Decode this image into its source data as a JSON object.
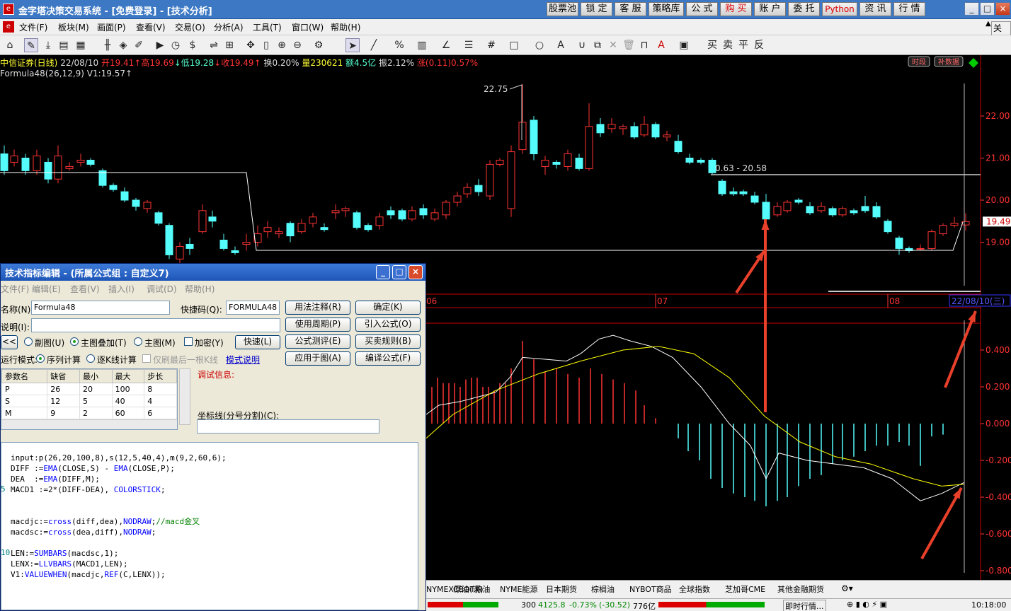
{
  "app": {
    "title": "金字塔决策交易系统 - [免费登录] - [技术分析]",
    "logo": "e"
  },
  "top_buttons": [
    "股票池",
    "锁 定",
    "客 服",
    "策略库",
    "公 式",
    "购 买",
    "账 户",
    "委 托",
    "Python",
    "资 讯",
    "行 情"
  ],
  "window_controls": {
    "minimize": "_",
    "restore": "□",
    "close": "×"
  },
  "menu": [
    "文件(F)",
    "板块(M)",
    "画面(P)",
    "查看(V)",
    "交易(O)",
    "分析(A)",
    "工具(T)",
    "窗口(W)",
    "帮助(H)"
  ],
  "menu_right": "关闭",
  "quote": {
    "name": "中信证券(日线)",
    "date": "22/08/10",
    "open": "开19.41",
    "high": "高19.69",
    "low": "低19.28",
    "close": "收19.49",
    "turnover": "换0.20%",
    "volume": "量230621",
    "amount": "额4.5亿",
    "amplitude": "振2.12%",
    "change": "涨(0.11)0.57%"
  },
  "formula_line": "Formula48(26,12,9) V1:19.57",
  "chart_badges": {
    "period": "时段",
    "supplement": "补数据"
  },
  "price_labels": {
    "peak": "22.75",
    "level": "0.63 - 20.58",
    "current": "19.49",
    "axis_ticks": [
      "22.00",
      "21.00",
      "20.00",
      "19.00"
    ]
  },
  "date_axis": {
    "labels": [
      "06",
      "07",
      "08"
    ],
    "current_date": "22/08/10(三)"
  },
  "macd_axis": {
    "ticks": [
      "0.400",
      "0.200",
      "0.000",
      "-0.200",
      "-0.400",
      "-0.600",
      "-0.800"
    ]
  },
  "dialog": {
    "title": "技术指标编辑 - (所属公式组 : 自定义7)",
    "menu": [
      "文件(F)",
      "编辑(E)",
      "查看(V)",
      "插入(I)",
      "调试(D)",
      "帮助(H)"
    ],
    "name_label": "名称(N):",
    "name_value": "Formula48",
    "shortcut_label": "快捷码(Q):",
    "shortcut_value": "FORMULA48",
    "desc_label": "说明(I):",
    "buttons": {
      "usage": "用法注释(R)",
      "ok": "确定(K)",
      "period": "使用周期(P)",
      "import": "引入公式(O)",
      "test": "公式测评(E)",
      "rules": "买卖规则(B)",
      "apply": "应用于图(A)",
      "compile": "编译公式(F)",
      "fast": "快速(L)",
      "back": "<<"
    },
    "radios": {
      "sub": "副图(U)",
      "overlay": "主图叠加(T)",
      "main": "主图(M)",
      "encrypt": "加密(Y)"
    },
    "run_mode_label": "运行模式:",
    "run_modes": {
      "serial": "序列计算",
      "single": "逐K线计算",
      "last": "仅刷最后一根K线"
    },
    "mode_link": "模式说明",
    "debug_label": "调试信息:",
    "axis_label": "坐标线(分号分割)(C):",
    "params_headers": [
      "参数名",
      "缺省",
      "最小",
      "最大",
      "步长"
    ],
    "params": [
      [
        "P",
        "26",
        "20",
        "100",
        "8"
      ],
      [
        "S",
        "12",
        "5",
        "40",
        "4"
      ],
      [
        "M",
        "9",
        "2",
        "60",
        "6"
      ]
    ]
  },
  "code_lines": [
    [
      "input",
      "",
      ":p(26,20,100,8),s(12,5,40,4),m(9,2,60,6);"
    ],
    [
      "DIFF :=",
      "EMA",
      "(CLOSE,S) - ",
      "EMA",
      "(CLOSE,P);"
    ],
    [
      "DEA  :=",
      "EMA",
      "(DIFF,M);"
    ],
    [
      "MACD1 :=2*(DIFF-DEA), ",
      "COLORSTICK",
      ";"
    ],
    [
      "",
      "",
      ""
    ],
    [
      "",
      "",
      ""
    ],
    [
      "macdjc:=",
      "cross",
      "(diff,dea),",
      "NODRAW",
      ";//macd金叉"
    ],
    [
      "macdsc:=",
      "cross",
      "(dea,diff),",
      "NODRAW",
      ";"
    ],
    [
      "",
      "",
      ""
    ],
    [
      "LEN:=",
      "SUMBARS",
      "(macdsc,1);"
    ],
    [
      "LENX:=",
      "LLVBARS",
      "(MACD1,LEN);"
    ],
    [
      "V1:",
      "VALUEWHEN",
      "(macdjc,",
      "REF",
      "(C,LENX));"
    ]
  ],
  "code_gutter": [
    "",
    "",
    "",
    "5",
    "",
    "",
    "",
    "",
    "",
    "10",
    "",
    "",
    ""
  ],
  "bottom_tabs": [
    "NYMEX原油(误)",
    "CBOT粮油",
    "NYME能源",
    "日本期货",
    "棕榈油",
    "NYBOT商品",
    "全球指数",
    "芝加哥CME",
    "其他金融期货"
  ],
  "ticker": {
    "index": "300",
    "value": "4125.8",
    "change": "-0.73%",
    "points": "(-30.52)",
    "amount": "776亿",
    "quote_btn": "即时行情...",
    "time": "10:18:00"
  },
  "colors": {
    "up": "#ff3333",
    "down": "#54fcfc",
    "yellow": "#ffff00",
    "white": "#ffffff"
  }
}
